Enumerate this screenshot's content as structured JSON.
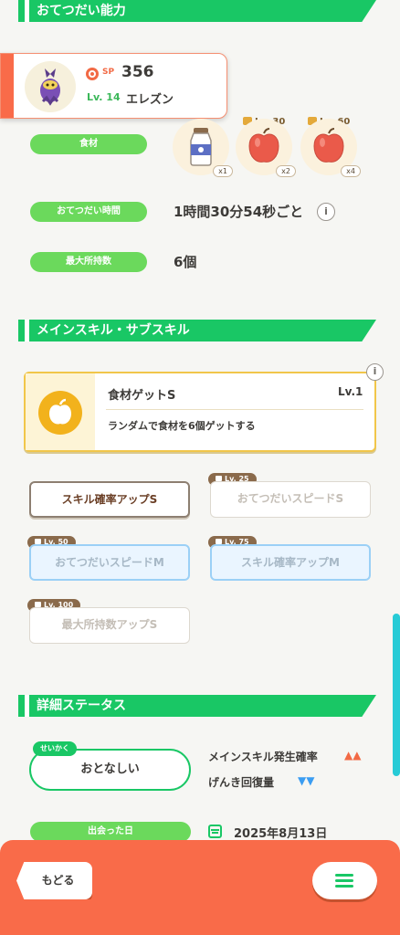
{
  "sections": {
    "helping": "おてつだい能力",
    "skills": "メインスキル・サブスキル",
    "details": "詳細ステータス"
  },
  "pokemon": {
    "sp_label": "SP",
    "sp_value": "356",
    "level": "Lv. 14",
    "name": "エレズン"
  },
  "ingredients": {
    "label": "食材",
    "items": [
      {
        "name": "milk-bottle-icon",
        "qty": "x1"
      },
      {
        "name": "apple-icon",
        "qty": "x2",
        "unlock": "Lv. 30"
      },
      {
        "name": "apple-icon",
        "qty": "x4",
        "unlock": "Lv. 60"
      }
    ]
  },
  "help_time": {
    "label": "おてつだい時間",
    "value": "1時間30分54秒ごと"
  },
  "max_carry": {
    "label": "最大所持数",
    "value": "6個"
  },
  "main_skill": {
    "name": "食材ゲットS",
    "level": "Lv.1",
    "description": "ランダムで食材を6個ゲットする"
  },
  "sub_skills": [
    {
      "label": "スキル確率アップS",
      "lock": ""
    },
    {
      "label": "おてつだいスピードS",
      "lock": "Lv. 25"
    },
    {
      "label": "おてつだいスピードM",
      "lock": "Lv. 50"
    },
    {
      "label": "スキル確率アップM",
      "lock": "Lv. 75"
    },
    {
      "label": "最大所持数アップS",
      "lock": "Lv. 100"
    }
  ],
  "nature": {
    "tag": "せいかく",
    "value": "おとなしい",
    "up_stat": "メインスキル発生確率",
    "up_arrows": "▲▲",
    "down_stat": "げんき回復量",
    "down_arrows": "▼▼"
  },
  "met_date": {
    "label": "出会った日",
    "value": "2025年8月13日"
  },
  "footer": {
    "back": "もどる"
  },
  "colors": {
    "accent": "#19c765",
    "footer": "#f96b49",
    "up": "#f26a45",
    "down": "#3b9df2"
  }
}
